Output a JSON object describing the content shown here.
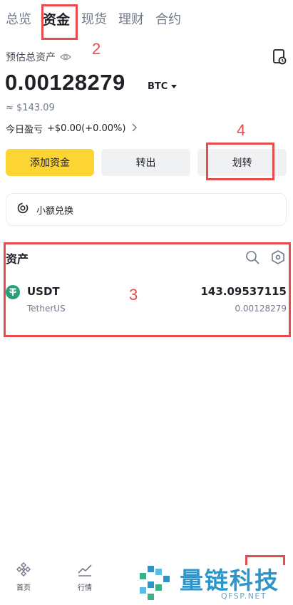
{
  "tabs": [
    {
      "label": "总览"
    },
    {
      "label": "资金",
      "active": true
    },
    {
      "label": "现货"
    },
    {
      "label": "理财"
    },
    {
      "label": "合约"
    }
  ],
  "header": {
    "estimated_label": "预估总资产",
    "balance": "0.00128279",
    "currency": "BTC",
    "approx_fiat": "≈ $143.09",
    "pnl_label": "今日盈亏",
    "pnl_value": "+$0.00(+0.00%)"
  },
  "actions": {
    "deposit": "添加资金",
    "withdraw": "转出",
    "transfer": "划转"
  },
  "small_convert": {
    "label": "小额兑换"
  },
  "assets": {
    "title": "资产",
    "items": [
      {
        "symbol": "USDT",
        "name": "TetherUS",
        "amount": "143.09537115",
        "btc_value": "0.00128279"
      }
    ]
  },
  "annotations": {
    "n2": "2",
    "n3": "3",
    "n4": "4"
  },
  "bottom_nav": [
    {
      "label": "首页",
      "icon": "home-diamond-icon"
    },
    {
      "label": "行情",
      "icon": "markets-chart-icon"
    }
  ],
  "watermark": {
    "text": "量链科技",
    "sub": "QFSP.NET"
  },
  "colors": {
    "accent": "#fcd535",
    "annotation": "#e84b4b",
    "watermark": "#2e95c9",
    "usdt": "#26a17b"
  }
}
